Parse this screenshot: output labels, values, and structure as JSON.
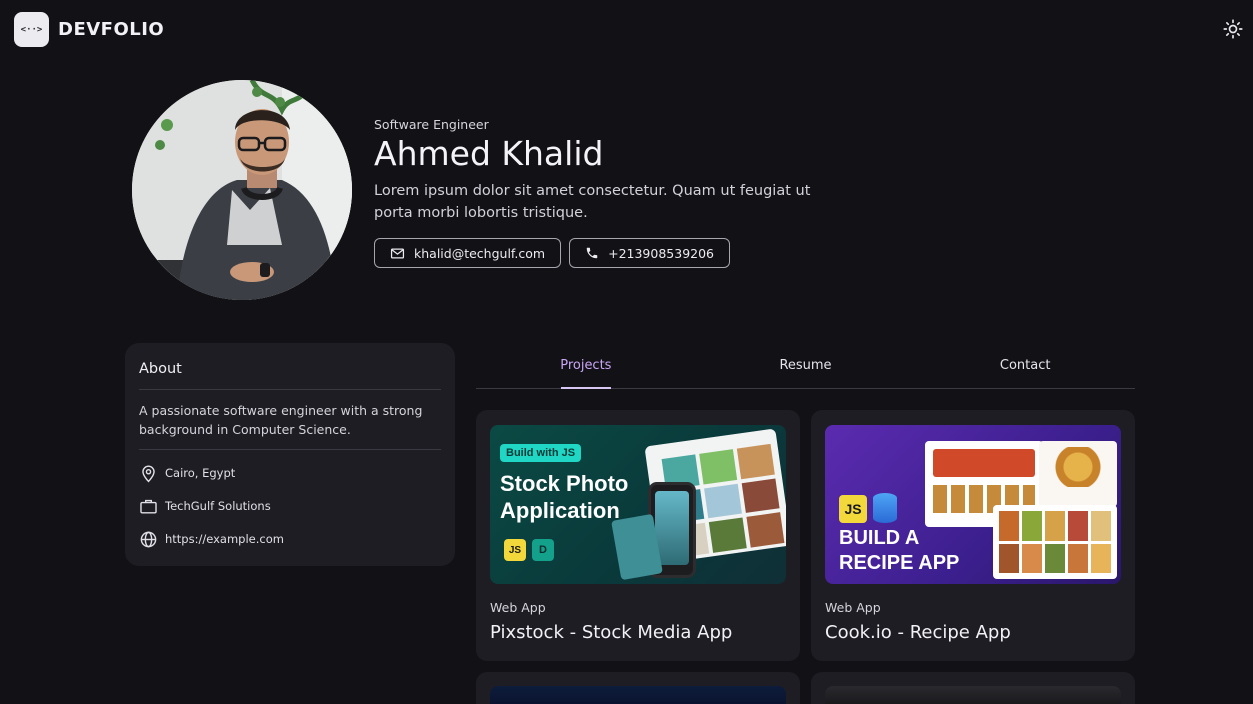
{
  "app": {
    "logo_text": "DEVFOLIO",
    "logo_badge": "<··>"
  },
  "hero": {
    "role": "Software Engineer",
    "name": "Ahmed Khalid",
    "bio": "Lorem ipsum dolor sit amet consectetur. Quam ut feugiat ut porta morbi lobortis tristique.",
    "email": "khalid@techgulf.com",
    "phone": "+213908539206"
  },
  "about": {
    "title": "About",
    "description": "A passionate software engineer with a strong background in Computer Science.",
    "items": [
      {
        "icon": "location-pin-icon",
        "label": "Cairo, Egypt"
      },
      {
        "icon": "briefcase-icon",
        "label": "TechGulf Solutions"
      },
      {
        "icon": "globe-icon",
        "label": "https://example.com"
      }
    ]
  },
  "tabs": [
    {
      "label": "Projects",
      "active": true
    },
    {
      "label": "Resume",
      "active": false
    },
    {
      "label": "Contact",
      "active": false
    }
  ],
  "projects": [
    {
      "category": "Web App",
      "title": "Pixstock - Stock Media App",
      "thumb": {
        "tag": "Build with JS",
        "headline_1": "Stock Photo",
        "headline_2": "Application",
        "badge": "JS"
      }
    },
    {
      "category": "Web App",
      "title": "Cook.io - Recipe App",
      "thumb": {
        "headline_1": "BUILD A",
        "headline_2": "RECIPE APP",
        "badge": "JS"
      }
    }
  ],
  "colors": {
    "background": "#121115",
    "card": "#1e1d23",
    "accent": "#c9a6f5"
  }
}
